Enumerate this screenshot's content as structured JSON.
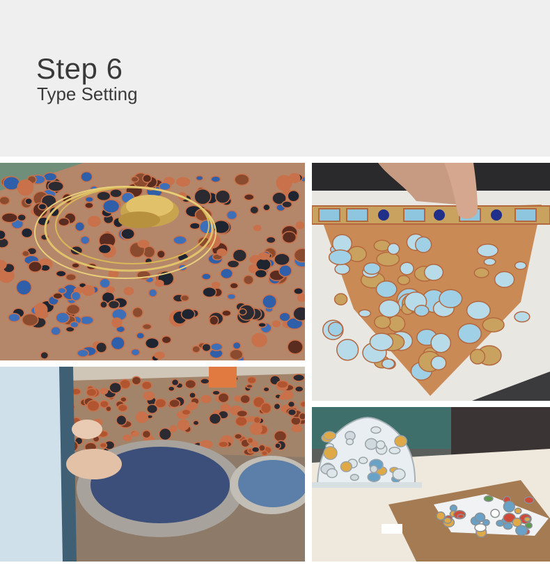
{
  "header": {
    "title": "Step 6",
    "subtitle": "Type Setting"
  },
  "photos": [
    {
      "subject": "copper-foiled glass pieces with brass parts and wire"
    },
    {
      "subject": "hands setting glass pieces into a lamp shade mold"
    },
    {
      "subject": "worker arranging foiled glass pieces in a bowl mold"
    },
    {
      "subject": "finished lamp shade beside a pattern board"
    }
  ],
  "colors": {
    "header_bg": "#efefef",
    "title_text": "#3a3a3a",
    "copper": "#c8714a",
    "glass_blue": "#2f5fa8",
    "glass_sky": "#9fd0e6",
    "glass_amber": "#c9a25f"
  }
}
